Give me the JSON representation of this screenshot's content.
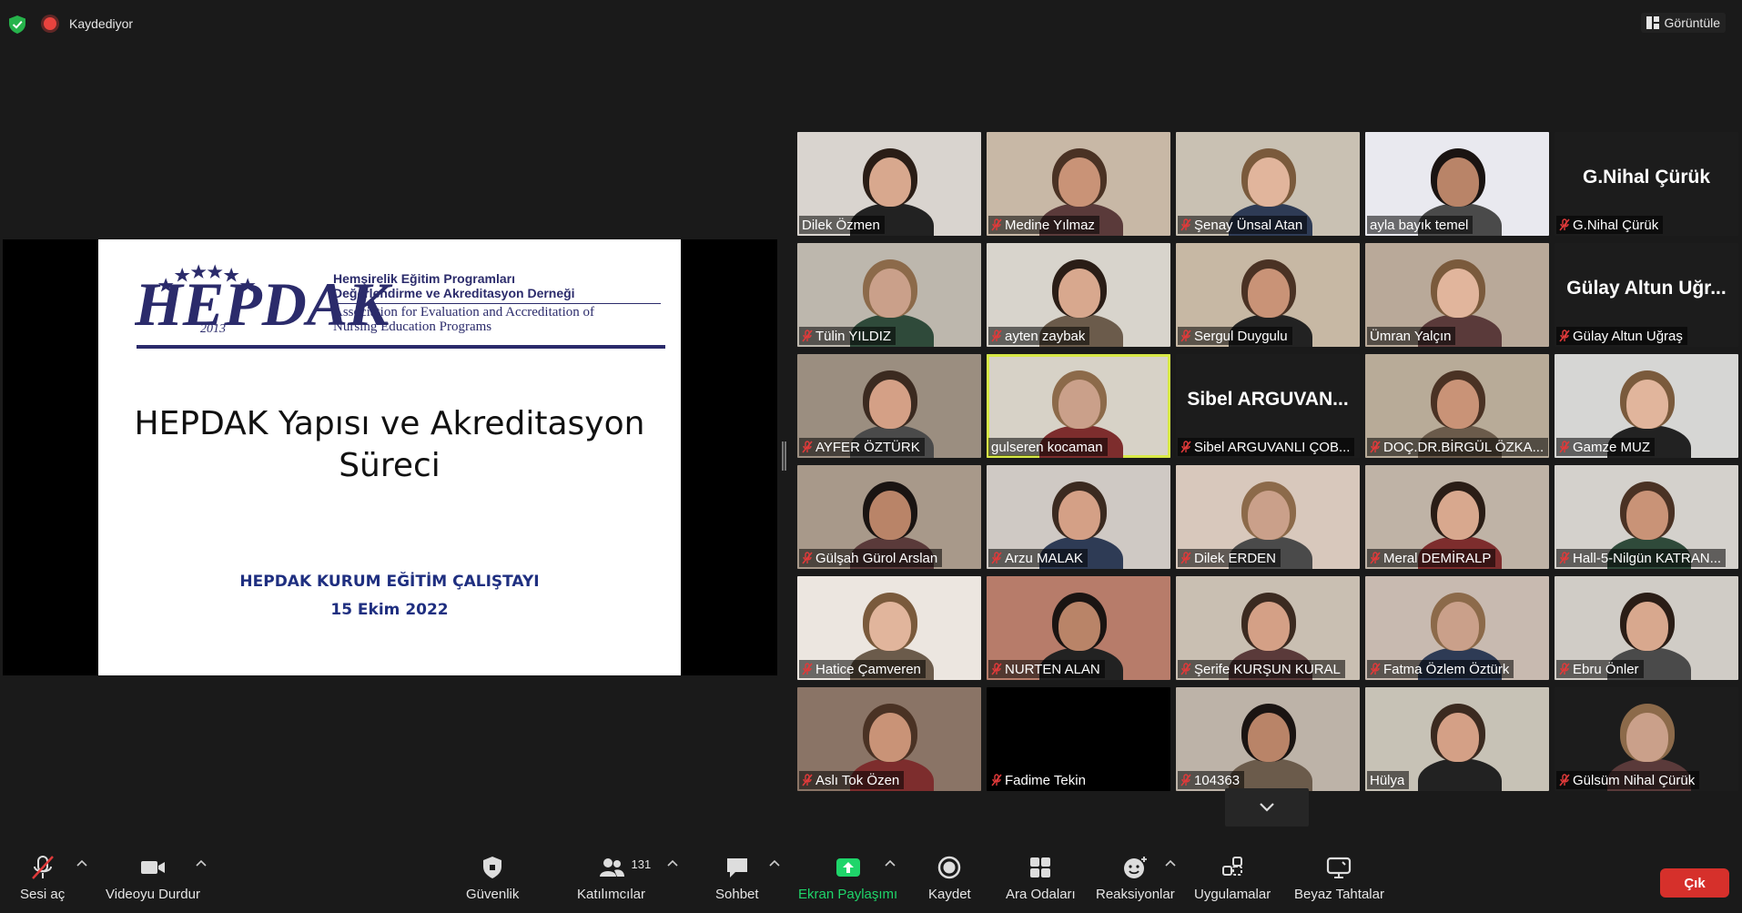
{
  "topbar": {
    "recording_label": "Kaydediyor",
    "view_label": "Görüntüle"
  },
  "share": {
    "org_line1": "Hemşirelik Eğitim Programları",
    "org_line2": "Değerlendirme ve Akreditasyon Derneği",
    "org_line3": "Association for Evaluation and Accreditation of",
    "org_line4": "Nursing Education Programs",
    "logo_word": "HEPDAK",
    "logo_year": "2013",
    "title_line1": "HEPDAK  Yapısı ve Akreditasyon",
    "title_line2": "Süreci",
    "subtitle1": "HEPDAK KURUM EĞİTİM ÇALIŞTAYI",
    "subtitle2": "15 Ekim 2022"
  },
  "participants": [
    {
      "name": "Dilek Özmen",
      "muted": false,
      "video": true,
      "bg": "#d9d4cf"
    },
    {
      "name": "Medine Yılmaz",
      "muted": true,
      "video": true,
      "bg": "#c8b8a6"
    },
    {
      "name": "Şenay Ünsal Atan",
      "muted": true,
      "video": true,
      "bg": "#c9c1b3"
    },
    {
      "name": "ayla bayık temel",
      "muted": false,
      "video": true,
      "bg": "#e9e9ef"
    },
    {
      "name": "G.Nihal Çürük",
      "muted": true,
      "video": false,
      "big_name": "G.Nihal Çürük"
    },
    {
      "name": "Tülin YILDIZ",
      "muted": true,
      "video": true,
      "bg": "#bdb7ad"
    },
    {
      "name": "ayten zaybak",
      "muted": true,
      "video": true,
      "bg": "#d8d4cc"
    },
    {
      "name": "Sergul Duygulu",
      "muted": true,
      "video": true,
      "bg": "#c7b8a4"
    },
    {
      "name": "Ümran Yalçın",
      "muted": false,
      "video": true,
      "bg": "#b9a999"
    },
    {
      "name": "Gülay Altun Uğraş",
      "muted": true,
      "video": false,
      "big_name": "Gülay Altun Uğr..."
    },
    {
      "name": "AYFER ÖZTÜRK",
      "muted": true,
      "video": true,
      "bg": "#9b8e80"
    },
    {
      "name": "gulseren kocaman",
      "muted": false,
      "video": true,
      "bg": "#d7d2c7",
      "active": true
    },
    {
      "name": "Sibel ARGUVANLI ÇOB...",
      "muted": true,
      "video": false,
      "big_name": "Sibel  ARGUVAN..."
    },
    {
      "name": "DOÇ.DR.BİRGÜL ÖZKA...",
      "muted": true,
      "video": true,
      "bg": "#b8ab98"
    },
    {
      "name": "Gamze MUZ",
      "muted": true,
      "video": true,
      "bg": "#d6d6d4"
    },
    {
      "name": "Gülşah Gürol Arslan",
      "muted": true,
      "video": true,
      "bg": "#a8998a"
    },
    {
      "name": "Arzu MALAK",
      "muted": true,
      "video": true,
      "bg": "#cfc9c4"
    },
    {
      "name": "Dilek ERDEN",
      "muted": true,
      "video": true,
      "bg": "#d8c8bc"
    },
    {
      "name": "Meral DEMİRALP",
      "muted": true,
      "video": true,
      "bg": "#bfb3a6"
    },
    {
      "name": "Hall-5-Nilgün KATRAN...",
      "muted": true,
      "video": true,
      "bg": "#d4d1cc"
    },
    {
      "name": "Hatice Çamveren",
      "muted": true,
      "video": true,
      "bg": "#ece6e0"
    },
    {
      "name": "NURTEN ALAN",
      "muted": true,
      "video": true,
      "bg": "#b77c6a"
    },
    {
      "name": "Şerife KURŞUN KURAL",
      "muted": true,
      "video": true,
      "bg": "#c9bfb2"
    },
    {
      "name": "Fatma Özlem Öztürk",
      "muted": true,
      "video": true,
      "bg": "#c8bab0"
    },
    {
      "name": "Ebru Önler",
      "muted": true,
      "video": true,
      "bg": "#d0ccc6"
    },
    {
      "name": "Aslı Tok Özen",
      "muted": true,
      "video": true,
      "bg": "#8a7466"
    },
    {
      "name": "Fadime Tekin",
      "muted": true,
      "video": false,
      "big_name": ""
    },
    {
      "name": "104363",
      "muted": true,
      "video": true,
      "bg": "#bdb3a8"
    },
    {
      "name": "Hülya",
      "muted": false,
      "video": true,
      "bg": "#c7c2b6"
    },
    {
      "name": "Gülsüm Nihal Çürük",
      "muted": true,
      "video": true,
      "bg": "#1c1c1c"
    }
  ],
  "toolbar": {
    "unmute_label": "Sesi aç",
    "stop_video_label": "Videoyu Durdur",
    "security_label": "Güvenlik",
    "participants_label": "Katılımcılar",
    "participants_count": "131",
    "chat_label": "Sohbet",
    "share_screen_label": "Ekran Paylaşımı",
    "record_label": "Kaydet",
    "breakout_label": "Ara Odaları",
    "reactions_label": "Reaksiyonlar",
    "apps_label": "Uygulamalar",
    "whiteboard_label": "Beyaz Tahtalar",
    "leave_label": "Çık"
  },
  "colors": {
    "background": "#1a1a1a",
    "active_speaker": "#d7e846",
    "share_green": "#1fd56a",
    "leave_red": "#d6302b",
    "mute_red": "#e03a3a"
  }
}
